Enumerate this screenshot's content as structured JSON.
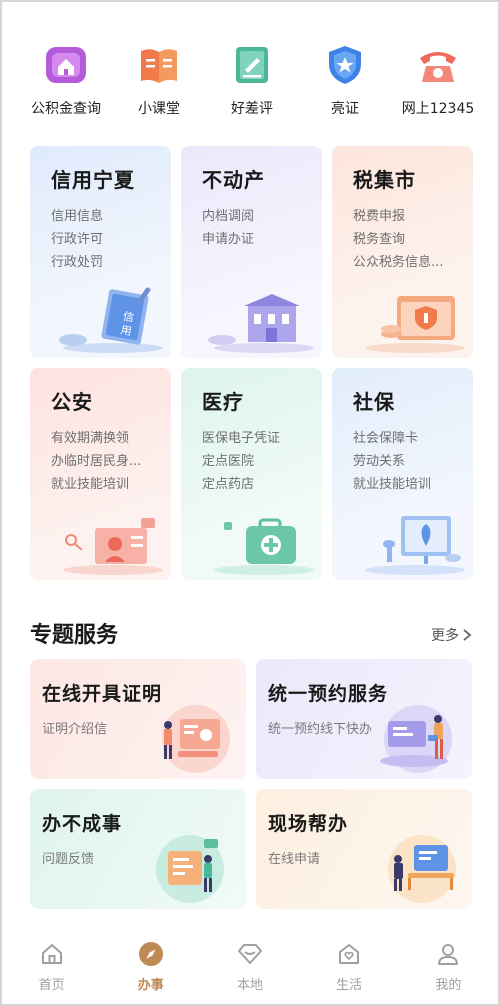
{
  "quick_services": [
    {
      "label": "公积金查询",
      "icon": "house-fund-icon"
    },
    {
      "label": "小课堂",
      "icon": "book-icon"
    },
    {
      "label": "好差评",
      "icon": "review-icon"
    },
    {
      "label": "亮证",
      "icon": "shield-star-icon"
    },
    {
      "label": "网上12345",
      "icon": "telephone-icon"
    }
  ],
  "categories": [
    {
      "title": "信用宁夏",
      "items": [
        "信用信息",
        "行政许可",
        "行政处罚"
      ]
    },
    {
      "title": "不动产",
      "items": [
        "内档调阅",
        "申请办证"
      ]
    },
    {
      "title": "税集市",
      "items": [
        "税费申报",
        "税务查询",
        "公众税务信息..."
      ]
    },
    {
      "title": "公安",
      "items": [
        "有效期满换领",
        "办临时居民身...",
        "就业技能培训"
      ]
    },
    {
      "title": "医疗",
      "items": [
        "医保电子凭证",
        "定点医院",
        "定点药店"
      ]
    },
    {
      "title": "社保",
      "items": [
        "社会保障卡",
        "劳动关系",
        "就业技能培训"
      ]
    }
  ],
  "special": {
    "title": "专题服务",
    "more": "更多",
    "cards": [
      {
        "title": "在线开具证明",
        "sub": "证明介绍信"
      },
      {
        "title": "统一预约服务",
        "sub": "统一预约线下快办"
      },
      {
        "title": "办不成事",
        "sub": "问题反馈"
      },
      {
        "title": "现场帮办",
        "sub": "在线申请"
      }
    ]
  },
  "nav": [
    {
      "label": "首页",
      "icon": "home-icon"
    },
    {
      "label": "办事",
      "icon": "compass-icon",
      "active": true
    },
    {
      "label": "本地",
      "icon": "diamond-icon"
    },
    {
      "label": "生活",
      "icon": "house-heart-icon"
    },
    {
      "label": "我的",
      "icon": "user-icon"
    }
  ],
  "colors": {
    "active_nav": "#c08a55",
    "inactive_nav": "#a0a0a0"
  }
}
